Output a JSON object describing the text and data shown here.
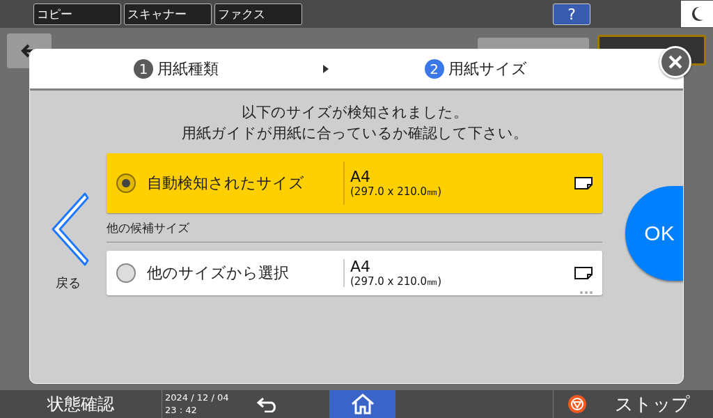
{
  "top_tabs": [
    {
      "label": "コピー"
    },
    {
      "label": "スキャナー"
    },
    {
      "label": "ファクス"
    }
  ],
  "help_button": "?",
  "dialog": {
    "steps": [
      {
        "number": "1",
        "label": "用紙種類",
        "selected": false
      },
      {
        "number": "2",
        "label": "用紙サイズ",
        "selected": true
      }
    ],
    "message": [
      "以下のサイズが検知されました。",
      "用紙ガイドが用紙に合っているか確認して下さい。"
    ],
    "options": [
      {
        "label": "自動検知されたサイズ",
        "size": "A4",
        "dimensions": "(297.0 x 210.0㎜)",
        "selected": true,
        "more": false
      },
      {
        "heading": "他の候補サイズ",
        "label": "他のサイズから選択",
        "size": "A4",
        "dimensions": "(297.0 x 210.0㎜)",
        "selected": false,
        "more": true
      }
    ],
    "back_label": "戻る",
    "ok_label": "OK"
  },
  "status_bar": {
    "status": "状態確認",
    "date": "2024 / 12 / 04",
    "time": "23 : 42",
    "stop": "ストップ"
  }
}
